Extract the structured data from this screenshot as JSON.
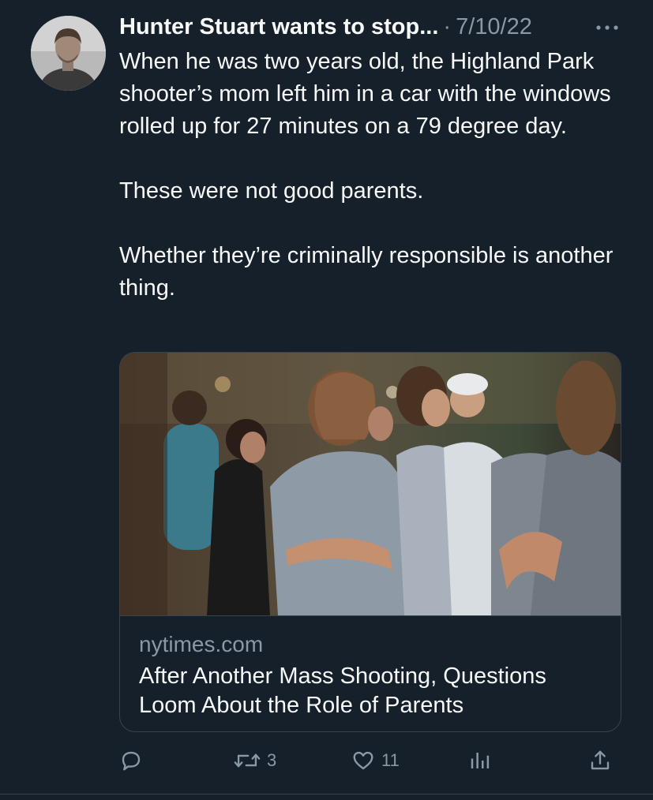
{
  "tweet": {
    "author_name": "Hunter Stuart wants to stop...",
    "separator": "·",
    "date": "7/10/22",
    "avatar_icon": "person-avatar",
    "more_icon": "more-dots-icon",
    "text": "When he was two years old, the Highland Park shooter’s mom left him in a car with the windows rolled up for 27 minutes on a 79 degree day.\n\nThese were not good parents.\n\nWhether they’re criminally responsible is another thing."
  },
  "card": {
    "domain": "nytimes.com",
    "title": "After Another Mass Shooting, Questions Loom About the Role of Parents"
  },
  "actions": {
    "reply": {
      "icon": "reply-icon",
      "count": ""
    },
    "retweet": {
      "icon": "retweet-icon",
      "count": "3"
    },
    "like": {
      "icon": "heart-icon",
      "count": "11"
    },
    "views": {
      "icon": "analytics-icon",
      "count": ""
    },
    "share": {
      "icon": "share-icon",
      "count": ""
    }
  },
  "colors": {
    "background": "#15202b",
    "text": "#f7f9f9",
    "secondary_text": "#8b98a5",
    "border": "#38444d"
  }
}
